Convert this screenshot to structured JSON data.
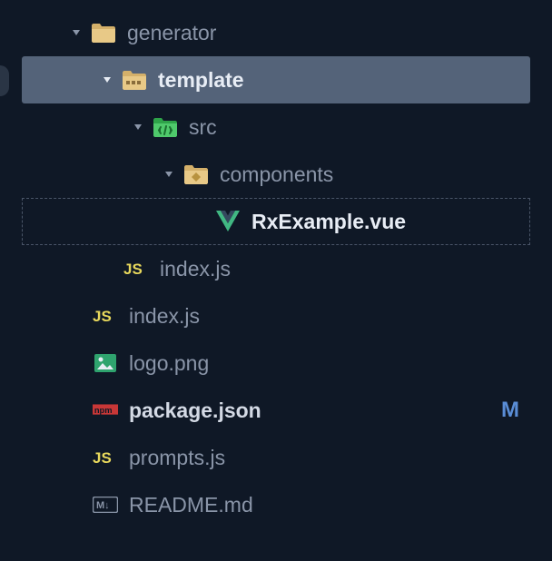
{
  "tree": {
    "generator": {
      "label": "generator"
    },
    "template": {
      "label": "template"
    },
    "src": {
      "label": "src"
    },
    "components": {
      "label": "components"
    },
    "rxexample": {
      "label": "RxExample.vue"
    },
    "index1": {
      "label": "index.js"
    },
    "index2": {
      "label": "index.js"
    },
    "logo": {
      "label": "logo.png"
    },
    "package": {
      "label": "package.json",
      "status": "M"
    },
    "prompts": {
      "label": "prompts.js"
    },
    "readme": {
      "label": "README.md"
    }
  }
}
